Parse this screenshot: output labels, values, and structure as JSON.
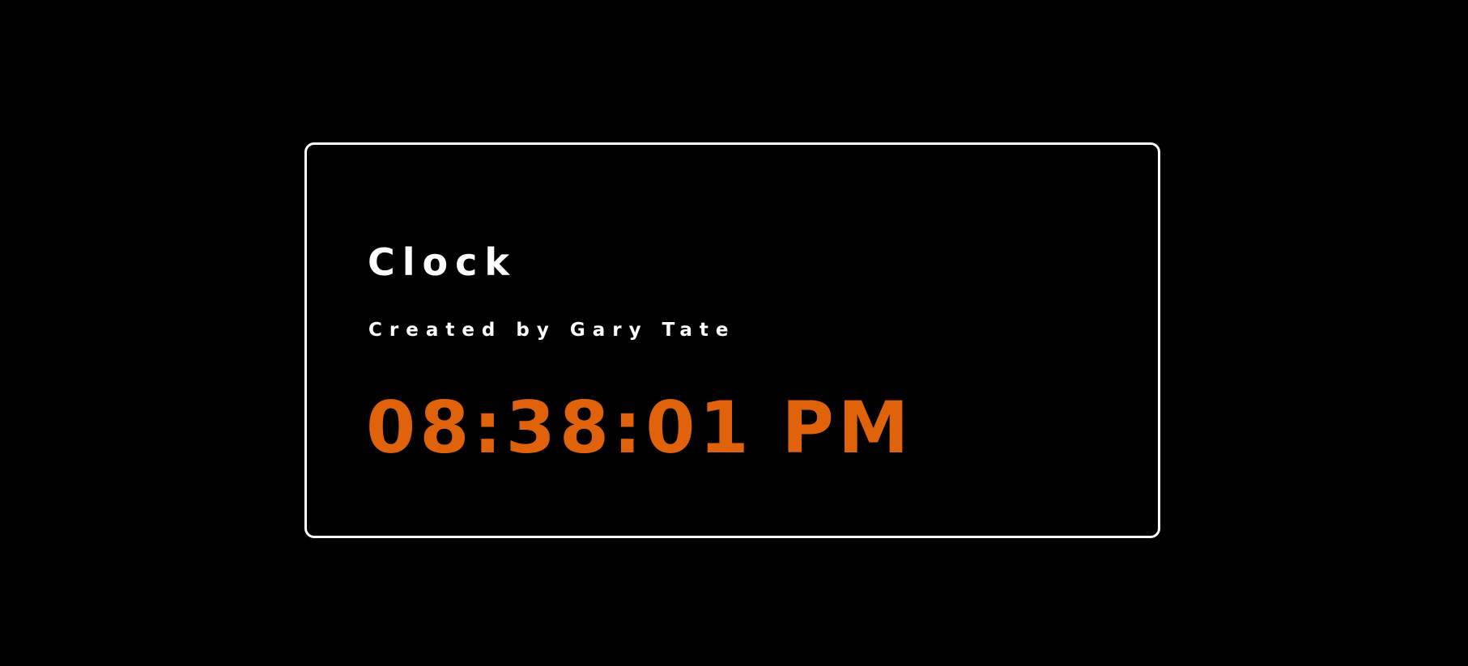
{
  "clock": {
    "title": "Clock",
    "subtitle": "Created by Gary Tate",
    "time": "08:38:01 PM"
  },
  "colors": {
    "background": "#000000",
    "card_border": "#ffffff",
    "text": "#ffffff",
    "time": "#e0620a"
  }
}
